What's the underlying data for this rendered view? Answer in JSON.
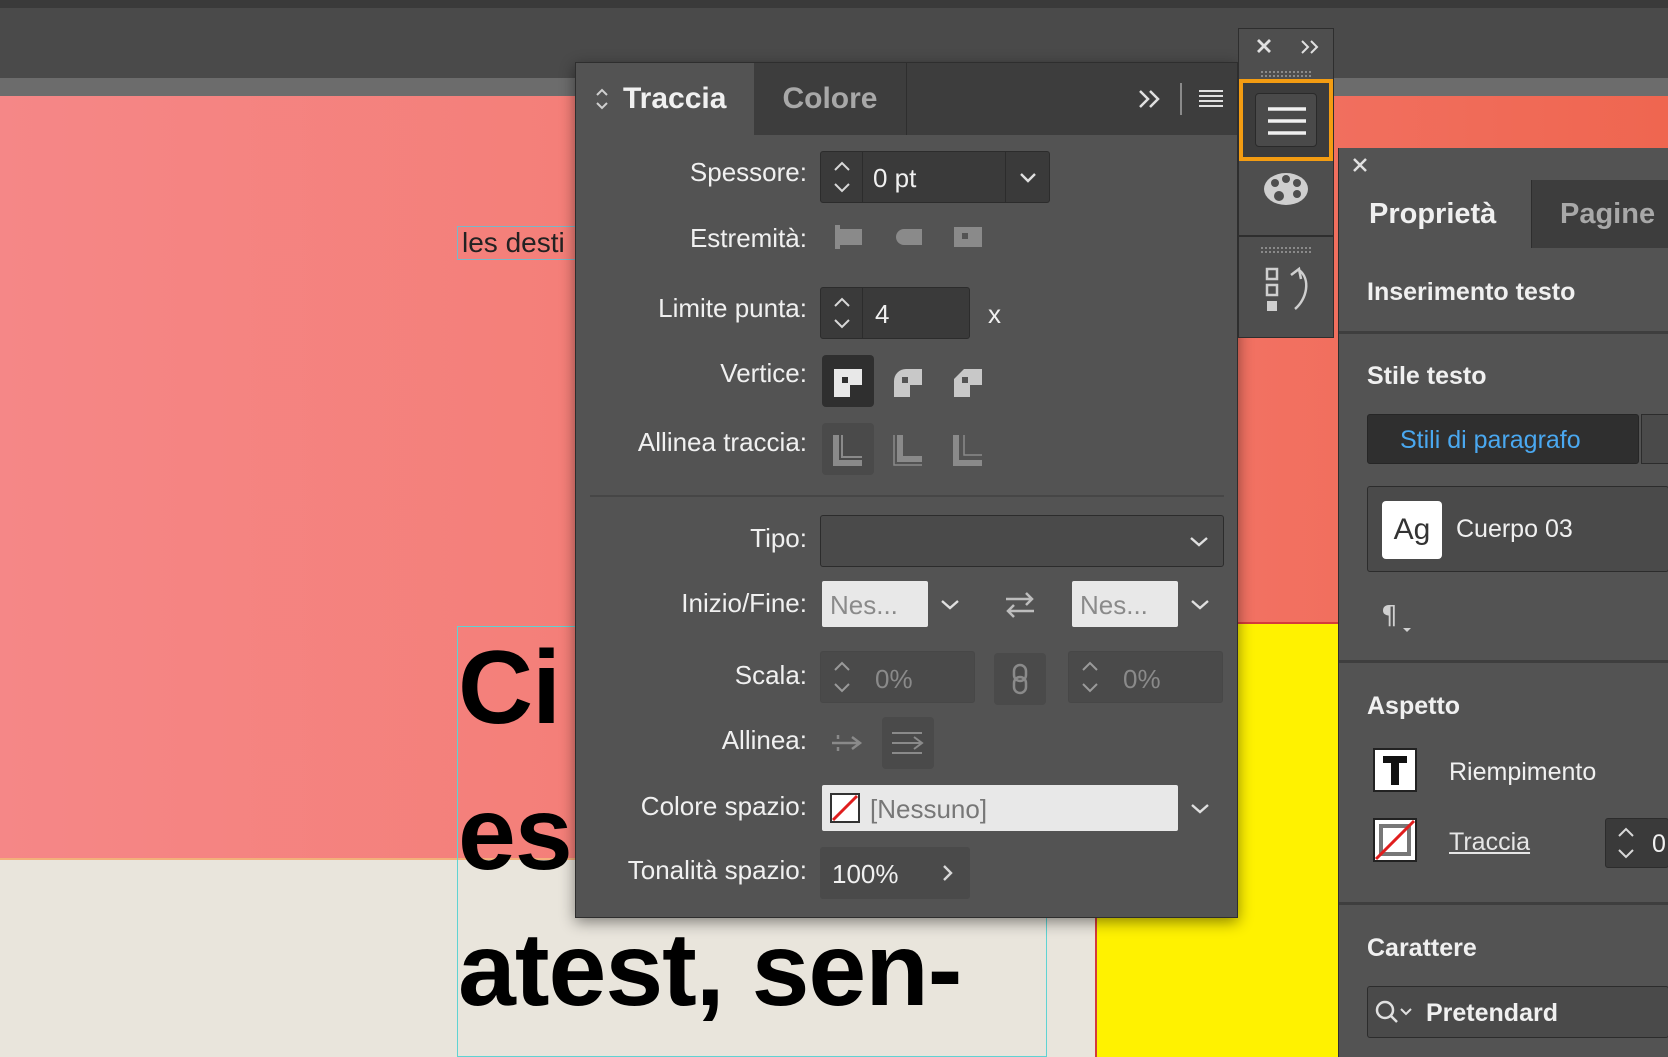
{
  "document": {
    "small_text": "les desti",
    "big_lines": [
      "Ci",
      "es",
      "atest, sen-"
    ]
  },
  "stroke_panel": {
    "tabs": {
      "traccia": "Traccia",
      "colore": "Colore"
    },
    "spessore": {
      "label": "Spessore:",
      "value": "0 pt"
    },
    "estremita": {
      "label": "Estremità:"
    },
    "limite_punta": {
      "label": "Limite punta:",
      "value": "4",
      "suffix": "x"
    },
    "vertice": {
      "label": "Vertice:"
    },
    "allinea_traccia": {
      "label": "Allinea traccia:"
    },
    "tipo": {
      "label": "Tipo:",
      "value": ""
    },
    "inizio_fine": {
      "label": "Inizio/Fine:",
      "start": "Nes...",
      "end": "Nes..."
    },
    "scala": {
      "label": "Scala:",
      "start": "0%",
      "end": "0%"
    },
    "allinea": {
      "label": "Allinea:"
    },
    "colore_spazio": {
      "label": "Colore spazio:",
      "value": "[Nessuno]"
    },
    "tonalita_spazio": {
      "label": "Tonalità spazio:",
      "value": "100%"
    }
  },
  "properties_panel": {
    "tabs": {
      "proprieta": "Proprietà",
      "pagine": "Pagine"
    },
    "mode": "Inserimento testo",
    "stile_testo": {
      "title": "Stile testo",
      "button": "Stili di paragrafo",
      "style_preview": "Ag",
      "style_name": "Cuerpo 03"
    },
    "aspetto": {
      "title": "Aspetto",
      "fill_label": "Riempimento",
      "stroke_label": "Traccia",
      "stroke_value": "0"
    },
    "carattere": {
      "title": "Carattere",
      "font": "Pretendard"
    }
  },
  "colors": {
    "panel_bg": "#535353",
    "tab_bar": "#3d3d3d",
    "highlight": "#f39c12",
    "link_blue": "#4aa8f0",
    "pink": "#f47a70",
    "yellow": "#fff200"
  }
}
